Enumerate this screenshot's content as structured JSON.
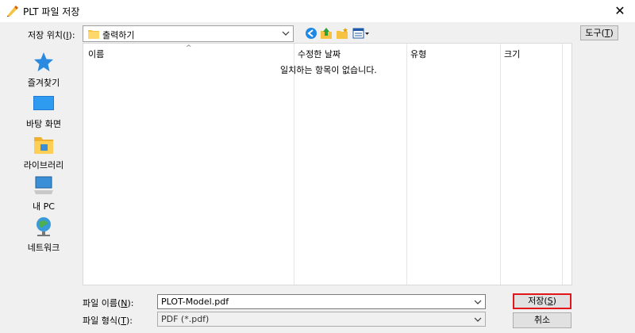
{
  "window": {
    "title": "PLT 파일 저장",
    "close_glyph": "✕"
  },
  "lookin": {
    "label": "저장 위치(",
    "label_key": "I",
    "label_end": "):",
    "value": "출력하기"
  },
  "toolbar_icons": [
    "back-icon",
    "up-folder-icon",
    "new-folder-icon",
    "view-menu-icon"
  ],
  "tools_button": {
    "label": "도구(",
    "key": "T",
    "end": ")"
  },
  "places": [
    {
      "label": "즐겨찾기",
      "icon": "star-icon"
    },
    {
      "label": "바탕 화면",
      "icon": "desktop-icon"
    },
    {
      "label": "라이브러리",
      "icon": "library-icon"
    },
    {
      "label": "내 PC",
      "icon": "computer-icon"
    },
    {
      "label": "네트워크",
      "icon": "network-icon"
    }
  ],
  "list": {
    "columns": [
      "이름",
      "수정한 날짜",
      "유형",
      "크기"
    ],
    "empty_message": "일치하는 항목이 없습니다."
  },
  "filename": {
    "label": "파일 이름(",
    "key": "N",
    "end": "):",
    "value": "PLOT-Model.pdf"
  },
  "filetype": {
    "label": "파일 형식(",
    "key": "T",
    "end": "):",
    "value": "PDF (*.pdf)"
  },
  "save_button": {
    "label": "저장(",
    "key": "S",
    "end": ")"
  },
  "cancel_button": {
    "label": "취소"
  },
  "colors": {
    "highlight": "#e3161b",
    "accent_blue": "#1e88e5",
    "folder_yellow": "#f5c242"
  }
}
